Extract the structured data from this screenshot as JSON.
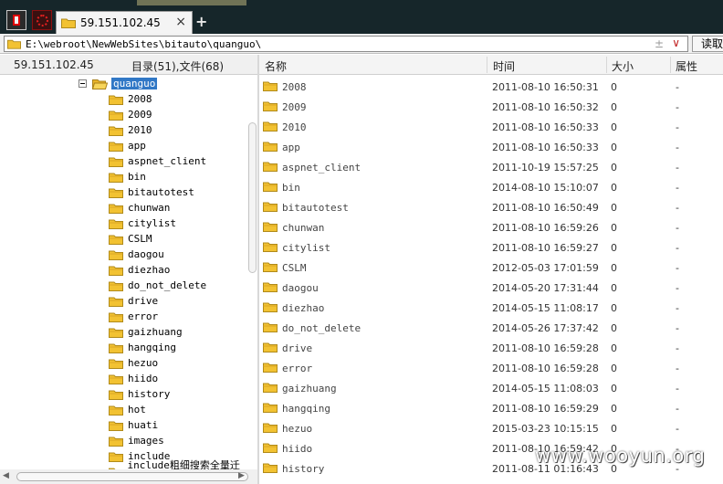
{
  "tabs": [
    {
      "title": "59.151.102.45",
      "close_icon": "×"
    }
  ],
  "tab_add_label": "+",
  "address": {
    "path": "E:\\webroot\\NewWebSites\\bitauto\\quanguo\\",
    "ctrl1": "±",
    "ctrl2": "∨",
    "read_button": "读取"
  },
  "left_pane": {
    "host": "59.151.102.45",
    "counts": "目录(51),文件(68)",
    "selected_folder": "quanguo",
    "tree_items": [
      "2008",
      "2009",
      "2010",
      "app",
      "aspnet_client",
      "bin",
      "bitautotest",
      "chunwan",
      "citylist",
      "CSLM",
      "daogou",
      "diezhao",
      "do_not_delete",
      "drive",
      "error",
      "gaizhuang",
      "hangqing",
      "hezuo",
      "hiido",
      "history",
      "hot",
      "huati",
      "images",
      "include",
      "include粗细搜索全量迁移"
    ]
  },
  "columns": {
    "name": "名称",
    "time": "时间",
    "size": "大小",
    "attr": "属性"
  },
  "files": [
    {
      "name": "2008",
      "time": "2011-08-10 16:50:31",
      "size": "0",
      "attr": "-"
    },
    {
      "name": "2009",
      "time": "2011-08-10 16:50:32",
      "size": "0",
      "attr": "-"
    },
    {
      "name": "2010",
      "time": "2011-08-10 16:50:33",
      "size": "0",
      "attr": "-"
    },
    {
      "name": "app",
      "time": "2011-08-10 16:50:33",
      "size": "0",
      "attr": "-"
    },
    {
      "name": "aspnet_client",
      "time": "2011-10-19 15:57:25",
      "size": "0",
      "attr": "-"
    },
    {
      "name": "bin",
      "time": "2014-08-10 15:10:07",
      "size": "0",
      "attr": "-"
    },
    {
      "name": "bitautotest",
      "time": "2011-08-10 16:50:49",
      "size": "0",
      "attr": "-"
    },
    {
      "name": "chunwan",
      "time": "2011-08-10 16:59:26",
      "size": "0",
      "attr": "-"
    },
    {
      "name": "citylist",
      "time": "2011-08-10 16:59:27",
      "size": "0",
      "attr": "-"
    },
    {
      "name": "CSLM",
      "time": "2012-05-03 17:01:59",
      "size": "0",
      "attr": "-"
    },
    {
      "name": "daogou",
      "time": "2014-05-20 17:31:44",
      "size": "0",
      "attr": "-"
    },
    {
      "name": "diezhao",
      "time": "2014-05-15 11:08:17",
      "size": "0",
      "attr": "-"
    },
    {
      "name": "do_not_delete",
      "time": "2014-05-26 17:37:42",
      "size": "0",
      "attr": "-"
    },
    {
      "name": "drive",
      "time": "2011-08-10 16:59:28",
      "size": "0",
      "attr": "-"
    },
    {
      "name": "error",
      "time": "2011-08-10 16:59:28",
      "size": "0",
      "attr": "-"
    },
    {
      "name": "gaizhuang",
      "time": "2014-05-15 11:08:03",
      "size": "0",
      "attr": "-"
    },
    {
      "name": "hangqing",
      "time": "2011-08-10 16:59:29",
      "size": "0",
      "attr": "-"
    },
    {
      "name": "hezuo",
      "time": "2015-03-23 10:15:15",
      "size": "0",
      "attr": "-"
    },
    {
      "name": "hiido",
      "time": "2011-08-10 16:59:42",
      "size": "0",
      "attr": "-"
    },
    {
      "name": "history",
      "time": "2011-08-11 01:16:43",
      "size": "0",
      "attr": "-"
    }
  ],
  "icons": {
    "folder": "folder-icon",
    "folder_open": "folder-open-icon",
    "collapse": "collapse-icon"
  },
  "colors": {
    "folder": "#f2c232",
    "selection": "#3178c6",
    "topbar": "#16262a"
  },
  "watermark": "www.wooyun.org"
}
